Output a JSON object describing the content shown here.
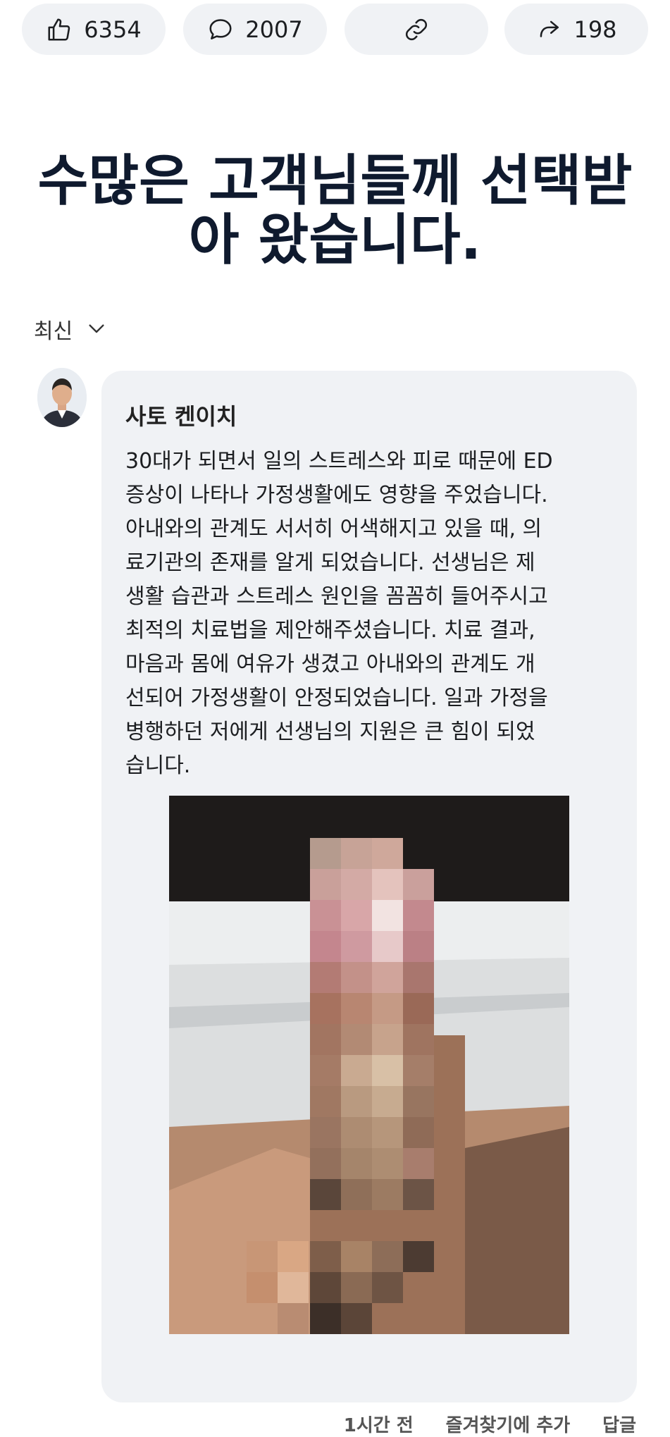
{
  "stats": {
    "likes": "6354",
    "comments": "2007",
    "shares": "198"
  },
  "headline": "수많은 고객님들께 선택받\n아 왔습니다.",
  "sort": {
    "label": "최신"
  },
  "comment": {
    "author": "사토 켄이치",
    "text": "30대가 되면서 일의 스트레스와 피로 때문에 ED\n증상이 나타나 가정생활에도 영향을 주었습니다.\n아내와의 관계도 서서히 어색해지고 있을 때, 의\n료기관의 존재를 알게 되었습니다. 선생님은 제\n생활 습관과 스트레스 원인을 꼼꼼히 들어주시고\n최적의 치료법을 제안해주셨습니다. 치료 결과,\n마음과 몸에 여유가 생겼고 아내와의 관계도 개\n선되어 가정생활이 안정되었습니다. 일과 가정을\n병행하던 저에게 선생님의 지원은 큰 힘이 되었\n습니다.",
    "time": "1시간 전",
    "favorite_label": "즐겨찾기에 추가",
    "reply_label": "답글"
  },
  "icons": {
    "like": "thumbs-up-icon",
    "comment": "speech-bubble-icon",
    "link": "link-icon",
    "share": "share-arrow-icon",
    "sort": "chevron-down-icon"
  },
  "colors": {
    "pill_bg": "#f0f2f5",
    "headline": "#0f1a2e",
    "bubble_bg": "#f0f2f5"
  }
}
